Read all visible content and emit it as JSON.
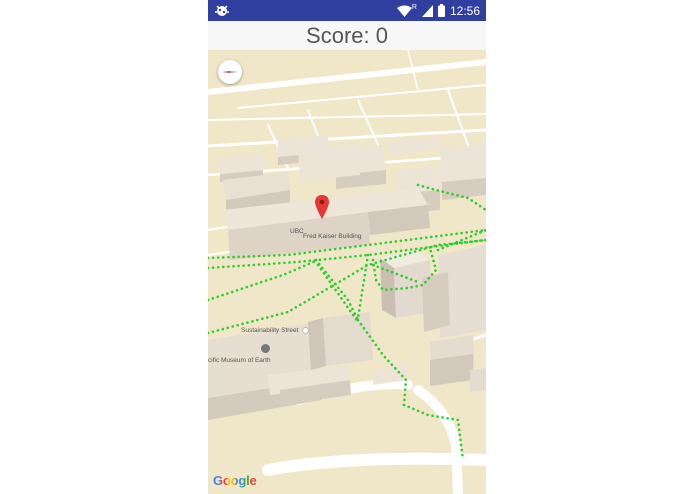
{
  "status_bar": {
    "time": "12:56",
    "network_badge": "R",
    "icons": [
      "debug-bug-icon",
      "wifi-icon",
      "cell-signal-icon",
      "battery-icon"
    ]
  },
  "score": {
    "label": "Score: 0"
  },
  "map": {
    "labels": {
      "building_prefix": "UBC",
      "building_name": "Fred Kaiser Building",
      "street": "Sustainability Street",
      "museum": "cific Museum of Earth"
    },
    "logo": "Google",
    "icons": [
      "compass-icon",
      "map-pin-icon",
      "poi-icon",
      "museum-icon"
    ],
    "colors": {
      "path_dots": "#2ecc2e",
      "pin": "#e53935",
      "ground": "#f0e7c9",
      "building": "#e6ded0",
      "status_bar": "#303f9f"
    }
  }
}
